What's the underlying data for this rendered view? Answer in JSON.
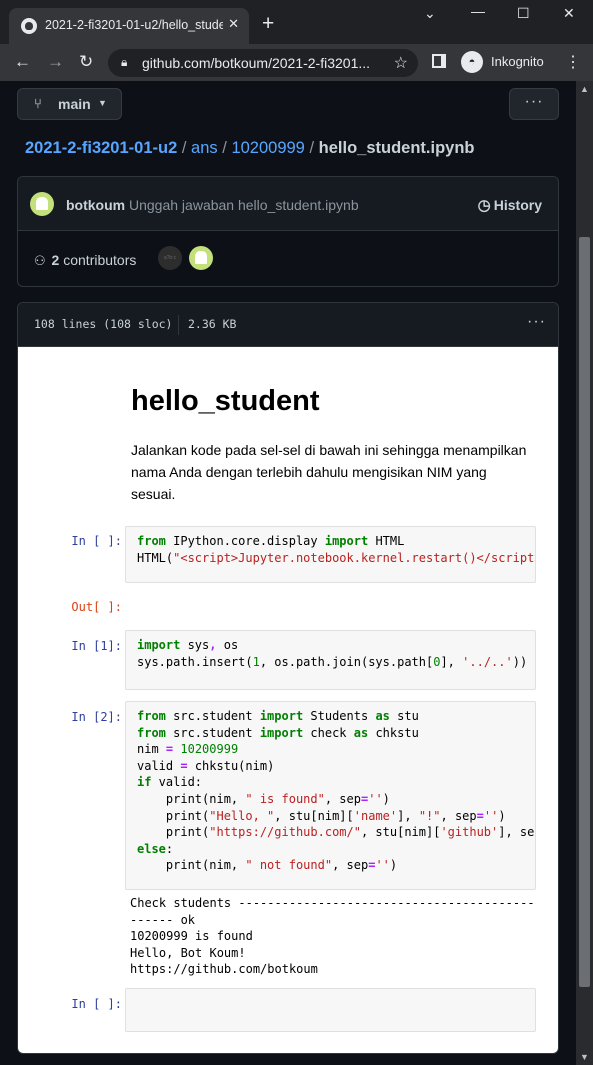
{
  "browser": {
    "tab_title": "2021-2-fi3201-01-u2/hello_stude",
    "tab_close": "✕",
    "new_tab": "+",
    "url": "github.com/botkoum/2021-2-fi3201...",
    "incognito_label": "Inkognito"
  },
  "repo": {
    "branch": "main",
    "breadcrumb": {
      "repo": "2021-2-fi3201-01-u2",
      "folder1": "ans",
      "folder2": "10200999",
      "file": "hello_student.ipynb",
      "sep": "/"
    }
  },
  "commit": {
    "author": "botkoum",
    "message": "Unggah jawaban hello_student.ipynb",
    "history_label": "History",
    "contributors_count": "2",
    "contributors_label": "contributors",
    "dark_avatar_text": "a?b:c"
  },
  "file": {
    "lines": "108 lines (108 sloc)",
    "size": "2.36 KB"
  },
  "notebook": {
    "title": "hello_student",
    "intro": "Jalankan kode pada sel-sel di bawah ini sehingga menampilkan nama Anda dengan terlebih dahulu mengisikan NIM yang sesuai.",
    "prompts": {
      "in_empty": "In [ ]:",
      "out_empty": "Out[ ]:",
      "in_1": "In [1]:",
      "in_2": "In [2]:",
      "in_last": "In [ ]:"
    },
    "output_lines": [
      "Check students -----------------------------------------",
      "------ ok",
      "10200999 is found",
      "Hello, Bot Koum!",
      "https://github.com/botkoum"
    ]
  },
  "colors": {
    "bg": "#0d1117",
    "link": "#58a6ff",
    "code_keyword": "#008000",
    "code_string": "#ba2121"
  },
  "icons": [
    "github-favicon",
    "back-arrow-icon",
    "forward-arrow-icon",
    "reload-icon",
    "lock-icon",
    "star-icon",
    "side-panel-icon",
    "incognito-icon",
    "kebab-menu-icon",
    "git-branch-icon",
    "history-icon",
    "people-icon"
  ]
}
